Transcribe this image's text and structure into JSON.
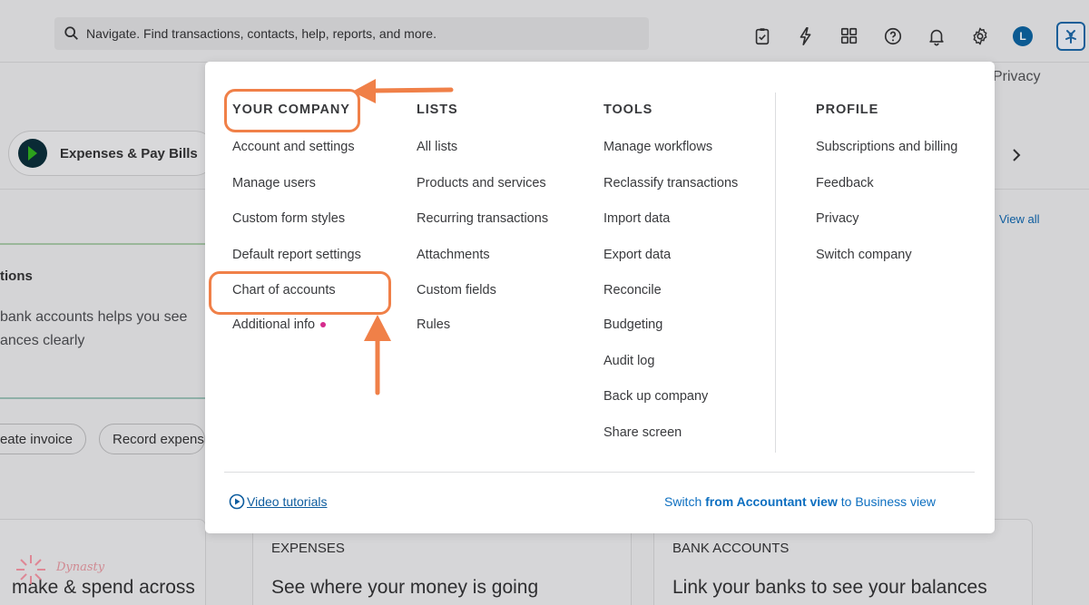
{
  "search": {
    "placeholder": "Navigate. Find transactions, contacts, help, reports, and more."
  },
  "top_icons": [
    "clipboard-icon",
    "lightning-icon",
    "apps-icon",
    "help-icon",
    "bell-icon",
    "gear-icon"
  ],
  "user": {
    "avatar_letter": "L"
  },
  "background": {
    "privacy": "Privacy",
    "expenses_pill": "Expenses & Pay Bills",
    "view_all": "View all",
    "card_title": "tions",
    "card_desc_line1": "bank accounts helps you see",
    "card_desc_line2": "ances clearly",
    "btn_invoice": "eate invoice",
    "btn_expense": "Record expense",
    "bottom_left_text": "make & spend across",
    "expenses_caption": "EXPENSES",
    "expenses_headline": "See where your money is going",
    "bank_caption": "BANK ACCOUNTS",
    "bank_headline": "Link your banks to see your balances",
    "watermark": "Dynasty"
  },
  "menu": {
    "your_company": {
      "title": "YOUR COMPANY",
      "items": [
        "Account and settings",
        "Manage users",
        "Custom form styles",
        "Default report settings",
        "Chart of accounts",
        "Additional info"
      ]
    },
    "lists": {
      "title": "LISTS",
      "items": [
        "All lists",
        "Products and services",
        "Recurring transactions",
        "Attachments",
        "Custom fields",
        "Rules"
      ]
    },
    "tools": {
      "title": "TOOLS",
      "items": [
        "Manage workflows",
        "Reclassify transactions",
        "Import data",
        "Export data",
        "Reconcile",
        "Budgeting",
        "Audit log",
        "Back up company",
        "Share screen"
      ]
    },
    "profile": {
      "title": "PROFILE",
      "items": [
        "Subscriptions and billing",
        "Feedback",
        "Privacy",
        "Switch company"
      ]
    },
    "video_tutorials": "Video tutorials",
    "switch_prefix": "Switch ",
    "switch_from": "from Accountant view",
    "switch_suffix": " to Business view"
  },
  "colors": {
    "annotation": "#f08048",
    "link": "#0d5c9e",
    "dot": "#d52b8c"
  }
}
